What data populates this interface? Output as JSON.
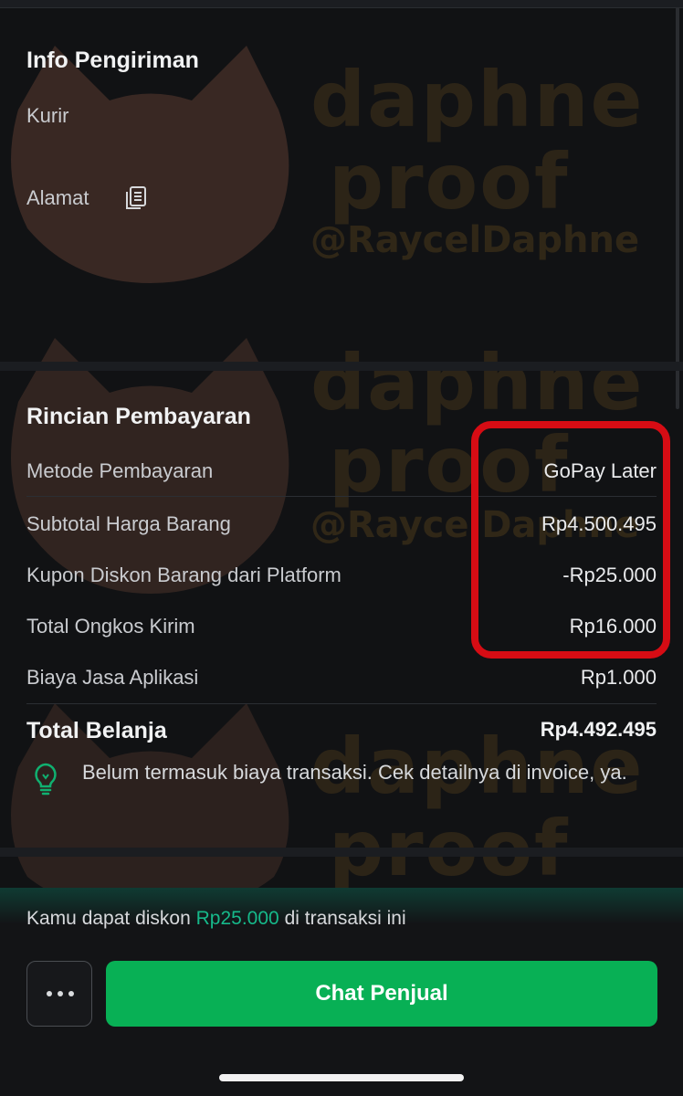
{
  "shipping": {
    "title": "Info Pengiriman",
    "courier_label": "Kurir",
    "address_label": "Alamat",
    "copy_icon": "copy-icon"
  },
  "payment": {
    "title": "Rincian Pembayaran",
    "rows": [
      {
        "label": "Metode Pembayaran",
        "value": "GoPay Later"
      },
      {
        "label": "Subtotal Harga Barang",
        "value": "Rp4.500.495"
      },
      {
        "label": "Kupon Diskon Barang dari Platform",
        "value": "-Rp25.000"
      },
      {
        "label": "Total Ongkos Kirim",
        "value": "Rp16.000"
      },
      {
        "label": "Biaya Jasa Aplikasi",
        "value": "Rp1.000"
      }
    ],
    "total_label": "Total Belanja",
    "total_value": "Rp4.492.495",
    "note": "Belum termasuk biaya transaksi. Cek detailnya di invoice, ya."
  },
  "bottom": {
    "promo_prefix": "Kamu dapat diskon",
    "promo_amount": "Rp25.000",
    "promo_suffix": "di transaksi ini",
    "chat_button": "Chat Penjual",
    "more_icon": "more-dots-icon"
  },
  "watermark": {
    "line1": "daphne",
    "line2": "proof",
    "handle": "@RaycelDaphne"
  },
  "colors": {
    "accent_green": "#08b055",
    "promo_green": "#16b98a",
    "highlight_red": "#d60c14",
    "background": "#111214"
  }
}
